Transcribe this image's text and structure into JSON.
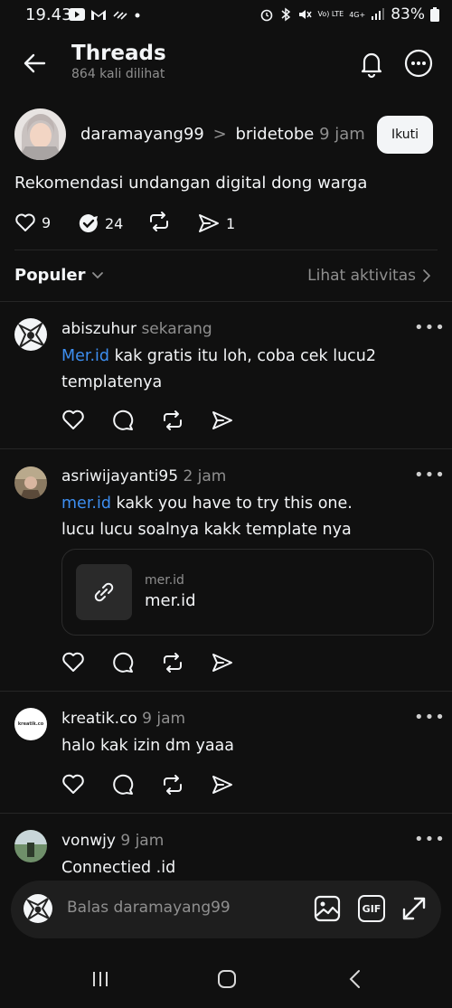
{
  "status": {
    "time": "19.43",
    "battery": "83%",
    "network": "4G+",
    "volte": "Vo) LTE"
  },
  "header": {
    "title": "Threads",
    "subtitle": "864 kali dilihat"
  },
  "post": {
    "author": "daramayang99",
    "separator": ">",
    "recipient": "bridetobe",
    "time": "9 jam",
    "follow_label": "Ikuti",
    "text": "Rekomendasi undangan digital dong warga",
    "likes": "9",
    "reposts": "24",
    "shares": "1"
  },
  "tabs": {
    "sort_label": "Populer",
    "activity_label": "Lihat aktivitas"
  },
  "replies": [
    {
      "user": "abiszuhur",
      "time": "sekarang",
      "link": "Mer.id",
      "text_line1": " kak gratis itu loh, coba cek lucu2",
      "text_line2": "templatenya"
    },
    {
      "user": "asriwijayanti95",
      "time": "2 jam",
      "link": "mer.id",
      "text_line1": " kakk you have to try this one.",
      "text_line2": "lucu lucu soalnya kakk template nya",
      "card_domain": "mer.id",
      "card_title": "mer.id"
    },
    {
      "user": "kreatik.co",
      "time": "9 jam",
      "text_line1": "halo kak izin dm yaaa",
      "avatar_text": "kreatik.co"
    },
    {
      "user": "vonwjy",
      "time": "9 jam",
      "text_line1": "Connectied .id"
    }
  ],
  "reply_bar": {
    "placeholder": "Balas daramayang99",
    "gif_label": "GIF"
  },
  "colors": {
    "background": "#101010",
    "text": "#f3f5f7",
    "muted": "#8f8f8f",
    "link": "#3d8ef0"
  }
}
